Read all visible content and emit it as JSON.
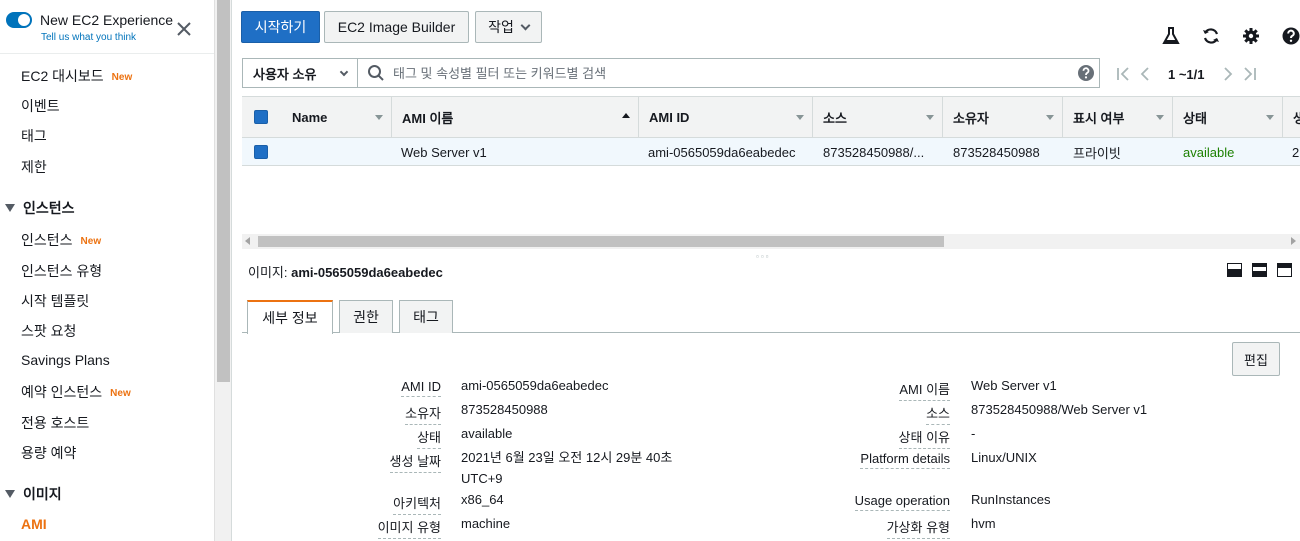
{
  "sidebar": {
    "banner_title": "New EC2 Experience",
    "banner_subtitle": "Tell us what you think",
    "new_badge": "New",
    "items": [
      {
        "label": "EC2 대시보드",
        "new": true
      },
      {
        "label": "이벤트"
      },
      {
        "label": "태그"
      },
      {
        "label": "제한"
      }
    ],
    "section_instances": "인스턴스",
    "instances_items": [
      {
        "label": "인스턴스",
        "new": true
      },
      {
        "label": "인스턴스 유형"
      },
      {
        "label": "시작 템플릿"
      },
      {
        "label": "스팟 요청"
      },
      {
        "label": "Savings Plans"
      },
      {
        "label": "예약 인스턴스",
        "new": true
      },
      {
        "label": "전용 호스트"
      },
      {
        "label": "용량 예약"
      }
    ],
    "section_images": "이미지",
    "images_items": [
      {
        "label": "AMI",
        "active": true
      }
    ]
  },
  "toolbar": {
    "launch_label": "시작하기",
    "builder_label": "EC2 Image Builder",
    "action_label": "작업"
  },
  "filter": {
    "owner_label": "사용자 소유",
    "search_placeholder": "태그 및 속성별 필터 또는 키워드별 검색"
  },
  "pager": {
    "text": "1 ~1/1"
  },
  "table": {
    "columns": [
      "Name",
      "AMI 이름",
      "AMI ID",
      "소스",
      "소유자",
      "표시 여부",
      "상태",
      "생"
    ],
    "rows": [
      {
        "name": "",
        "ami_name": "Web Server v1",
        "ami_id": "ami-0565059da6eabedec",
        "source": "873528450988/...",
        "owner": "873528450988",
        "visibility": "프라이빗",
        "status": "available",
        "created": "2"
      }
    ]
  },
  "detail": {
    "title_prefix": "이미지: ",
    "title_id": "ami-0565059da6eabedec",
    "tabs": [
      "세부 정보",
      "권한",
      "태그"
    ],
    "edit_label": "편집",
    "left_fields": [
      {
        "label": "AMI ID",
        "value": "ami-0565059da6eabedec"
      },
      {
        "label": "소유자",
        "value": "873528450988"
      },
      {
        "label": "상태",
        "value": "available"
      },
      {
        "label": "생성 날짜",
        "value": "2021년 6월 23일 오전 12시 29분 40초",
        "value2": "UTC+9"
      },
      {
        "label": "아키텍처",
        "value": "x86_64"
      },
      {
        "label": "이미지 유형",
        "value": "machine"
      }
    ],
    "right_fields": [
      {
        "label": "AMI 이름",
        "value": "Web Server v1"
      },
      {
        "label": "소스",
        "value": "873528450988/Web Server v1"
      },
      {
        "label": "상태 이유",
        "value": "-"
      },
      {
        "label": "Platform details",
        "value": "Linux/UNIX"
      },
      {
        "label": "Usage operation",
        "value": "RunInstances"
      },
      {
        "label": "가상화 유형",
        "value": "hvm"
      }
    ]
  },
  "colors": {
    "accent": "#1f6fc5",
    "brand_orange": "#ec7211",
    "status_ok": "#1d8102"
  }
}
